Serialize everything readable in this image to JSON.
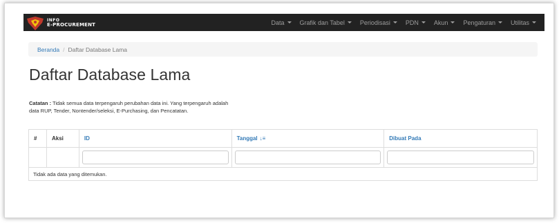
{
  "brand": {
    "line1": "INFO",
    "line2": "E-PROCUREMENT",
    "logo_color": "#c0392b",
    "logo_accent": "#f1c40f"
  },
  "nav": {
    "items": [
      {
        "label": "Data"
      },
      {
        "label": "Grafik dan Tabel"
      },
      {
        "label": "Periodisasi"
      },
      {
        "label": "PDN"
      },
      {
        "label": "Akun"
      },
      {
        "label": "Pengaturan"
      },
      {
        "label": "Utilitas"
      }
    ],
    "background": "#222222",
    "text_color": "#9d9d9d"
  },
  "breadcrumb": {
    "home": "Beranda",
    "separator": "/",
    "current": "Daftar Database Lama"
  },
  "page": {
    "title": "Daftar Database Lama"
  },
  "note": {
    "label": "Catatan :",
    "line1": " Tidak semua data terpengaruh perubahan data ini. Yang terpengaruh adalah",
    "line2": "data RUP, Tender, Nontender/seleksi, E-Purchasing, dan Pencatatan."
  },
  "table": {
    "columns": {
      "num": "#",
      "aksi": "Aksi",
      "id": "ID",
      "tanggal": "Tanggal",
      "dibuat_pada": "Dibuat Pada"
    },
    "sort_icon": "sort-descending-icon",
    "filters": {
      "id": "",
      "tanggal": "",
      "dibuat_pada": ""
    },
    "empty_message": "Tidak ada data yang ditemukan."
  },
  "colors": {
    "link": "#337ab7",
    "border": "#dddddd"
  }
}
